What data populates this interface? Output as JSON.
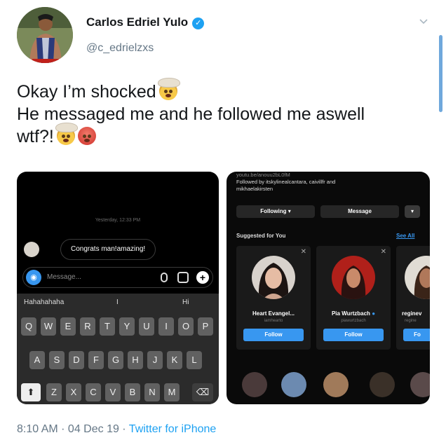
{
  "author": {
    "name": "Carlos Edriel Yulo",
    "handle": "@c_edrielzxs",
    "verified_icon": "verified-badge-icon"
  },
  "tweet": {
    "line1": "Okay I’m shocked",
    "line2": "He messaged me and he followed me aswell",
    "line3": "wtf?!"
  },
  "dm_screenshot": {
    "timestamp": "Yesterday, 12:33 PM",
    "message": "Congrats man!amazing!",
    "placeholder": "Message...",
    "suggestions": [
      "Hahahahaha",
      "I",
      "Hi"
    ],
    "keyboard_rows": [
      [
        "Q",
        "W",
        "E",
        "R",
        "T",
        "Y",
        "U",
        "I",
        "O",
        "P"
      ],
      [
        "A",
        "S",
        "D",
        "F",
        "G",
        "H",
        "J",
        "K",
        "L"
      ],
      [
        "Z",
        "X",
        "C",
        "V",
        "B",
        "N",
        "M"
      ]
    ]
  },
  "profile_screenshot": {
    "header_cut": "youtu.be/anouu2bL0fM",
    "followed_by": "Followed by itskylinealcantara, caivillfr and",
    "followed_by2": "mikhaelakirsten",
    "following_label": "Following",
    "message_label": "Message",
    "suggested_label": "Suggested for You",
    "see_all": "See All",
    "cards": [
      {
        "name": "Heart Evangel...",
        "user": "iamhearto",
        "follow": "Follow"
      },
      {
        "name": "Pia Wurtzbach",
        "user": "piawurtzbach",
        "follow": "Follow"
      },
      {
        "name": "reginev",
        "user": "regine",
        "follow": "Fo"
      }
    ]
  },
  "footer": {
    "time": "8:10 AM · 04 Dec 19 ·",
    "source": "Twitter for iPhone"
  },
  "colors": {
    "accent": "#1da1f2",
    "ig_blue": "#3897f0"
  }
}
